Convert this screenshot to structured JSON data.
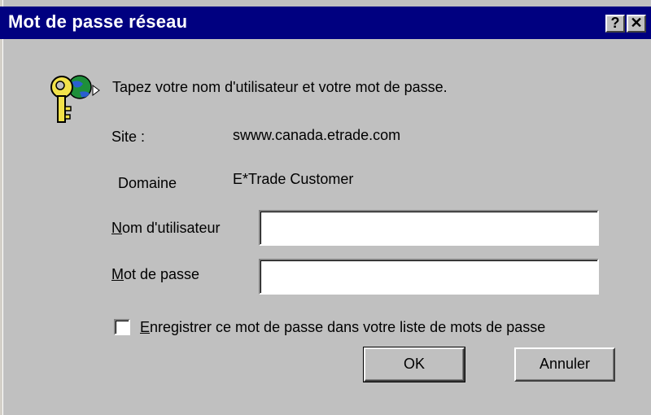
{
  "window": {
    "title": "Mot de passe réseau",
    "help_glyph": "?",
    "close_glyph": "✕"
  },
  "icon": "key-globe-icon",
  "prompt": "Tapez votre nom d'utilisateur et votre mot de passe.",
  "site": {
    "label": "Site :",
    "value": "swww.canada.etrade.com"
  },
  "domain": {
    "label": "Domaine",
    "value": "E*Trade Customer"
  },
  "username": {
    "label_mnemonic": "N",
    "label_rest": "om d'utilisateur",
    "value": ""
  },
  "password": {
    "label_mnemonic": "M",
    "label_rest": "ot de passe",
    "value": ""
  },
  "save_password": {
    "checked": false,
    "label_mnemonic": "E",
    "label_rest": "nregistrer ce mot de passe dans votre liste de mots de passe"
  },
  "buttons": {
    "ok": "OK",
    "cancel": "Annuler"
  }
}
